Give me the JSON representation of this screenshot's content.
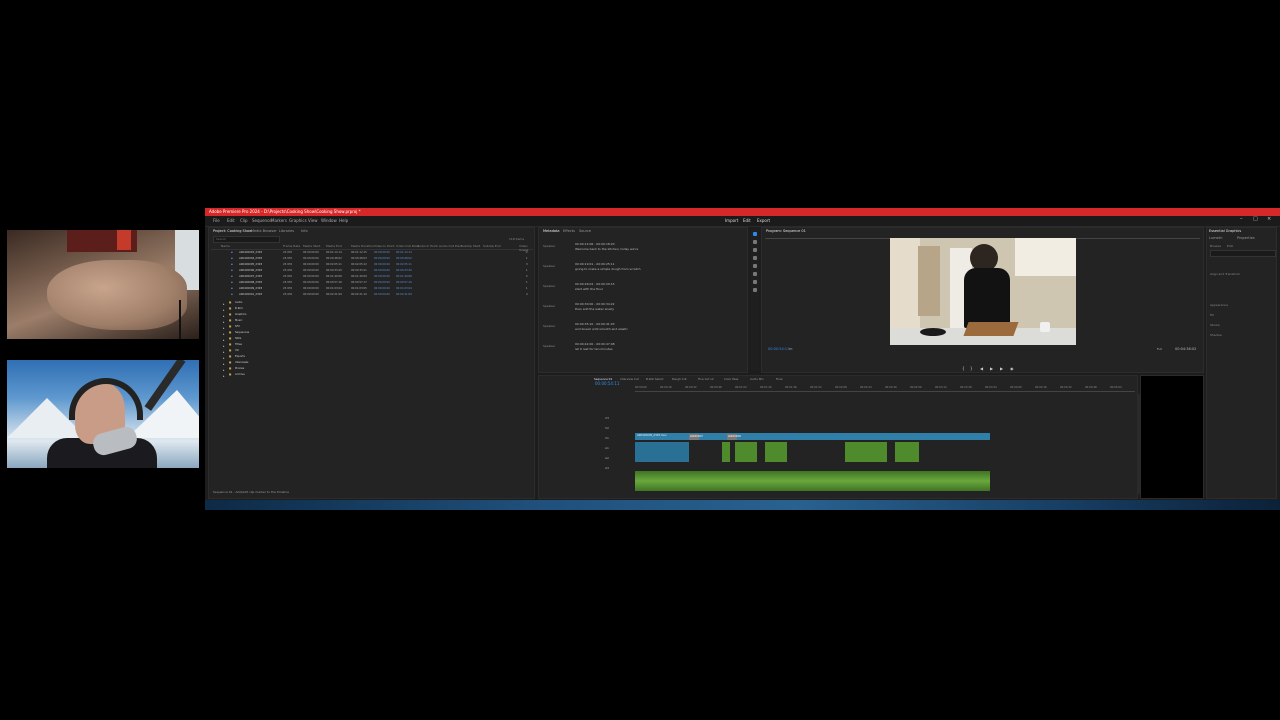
{
  "window": {
    "title": "Adobe Premiere Pro 2024 - D:\\Projects\\Cooking Show\\Cooking Show.prproj *",
    "menu": [
      "File",
      "Edit",
      "Clip",
      "Sequence",
      "Markers",
      "Graphics",
      "View",
      "Window",
      "Help"
    ],
    "controls": [
      "–",
      "□",
      "×"
    ]
  },
  "workspace_tabs": [
    "Import",
    "Edit",
    "Export"
  ],
  "project": {
    "tabs": [
      "Project: Cooking Show",
      "Media Browser",
      "Libraries",
      "Info"
    ],
    "search_placeholder": "Search",
    "item_count": "118 items",
    "columns": [
      "Name",
      "Frame Rate",
      "Media Start",
      "Media End",
      "Media Duration",
      "Video In Point",
      "Video Out Point",
      "Audio In Point",
      "Audio Out Point",
      "Subclip Start",
      "Subclip End",
      "Video Usage"
    ],
    "rows": [
      {
        "name": "A004C0003_2303",
        "fps": "23.976",
        "start": "00:00:00:00",
        "end": "00:01:12:14",
        "dur": "00:01:12:15",
        "vin": "00:00:00:00",
        "vout": "00:01:12:14",
        "use": "2"
      },
      {
        "name": "A004C0004_2303",
        "fps": "23.976",
        "start": "00:00:00:00",
        "end": "00:00:48:02",
        "dur": "00:00:48:03",
        "vin": "00:00:00:00",
        "vout": "00:00:48:02",
        "use": "1"
      },
      {
        "name": "A004C0005_2303",
        "fps": "23.976",
        "start": "00:00:00:00",
        "end": "00:02:05:11",
        "dur": "00:02:05:12",
        "vin": "00:00:00:00",
        "vout": "00:02:05:11",
        "use": "3"
      },
      {
        "name": "A004C0006_2303",
        "fps": "23.976",
        "start": "00:00:00:00",
        "end": "00:00:33:20",
        "dur": "00:00:33:21",
        "vin": "00:00:00:00",
        "vout": "00:00:33:20",
        "use": "1"
      },
      {
        "name": "A004C0007_2303",
        "fps": "23.976",
        "start": "00:00:00:00",
        "end": "00:01:40:08",
        "dur": "00:01:40:09",
        "vin": "00:00:00:00",
        "vout": "00:01:40:08",
        "use": "2"
      },
      {
        "name": "A004C0008_2303",
        "fps": "23.976",
        "start": "00:00:00:00",
        "end": "00:00:57:16",
        "dur": "00:00:57:17",
        "vin": "00:00:00:00",
        "vout": "00:00:57:16",
        "use": "1"
      },
      {
        "name": "A004C0009_2303",
        "fps": "23.976",
        "start": "00:00:00:00",
        "end": "00:01:03:04",
        "dur": "00:01:03:05",
        "vin": "00:00:00:00",
        "vout": "00:01:03:04",
        "use": "1"
      },
      {
        "name": "A004C0010_2303",
        "fps": "23.976",
        "start": "00:00:00:00",
        "end": "00:02:21:09",
        "dur": "00:02:21:10",
        "vin": "00:00:00:00",
        "vout": "00:02:21:09",
        "use": "4"
      }
    ],
    "bins": [
      "Audio",
      "B-Roll",
      "Graphics",
      "Music",
      "SFX",
      "Sequences",
      "Stills",
      "Titles",
      "VO",
      "Exports",
      "Interviews",
      "Proxies",
      "Archive"
    ],
    "footer": "Sequence 01 - Add/edit clip marker to the timeline"
  },
  "metadata": {
    "tabs": [
      "Metadata",
      "Effects",
      "Source"
    ],
    "entries": [
      {
        "label": "Speaker",
        "time": "00:00:12:06 - 00:00:18:20",
        "text": "Welcome back to the kitchen, today we're"
      },
      {
        "label": "Speaker",
        "time": "00:00:19:01 - 00:00:25:11",
        "text": "going to make a simple dough from scratch"
      },
      {
        "label": "Speaker",
        "time": "00:00:26:02 - 00:00:29:15",
        "text": "start with the flour"
      },
      {
        "label": "Speaker",
        "time": "00:00:30:00 - 00:00:34:22",
        "text": "then add the water slowly"
      },
      {
        "label": "Speaker",
        "time": "00:00:35:10 - 00:00:41:03",
        "text": "and knead until smooth and elastic"
      },
      {
        "label": "Speaker",
        "time": "00:00:42:00 - 00:00:47:08",
        "text": "let it rest for ten minutes"
      }
    ]
  },
  "program": {
    "tab": "Program: Sequence 01",
    "timecode_left": "00:00:54:11",
    "fit": "Fit",
    "quality": "Full",
    "timecode_right": "00:04:38:02"
  },
  "timeline": {
    "tabs": [
      "Sequence 01",
      "Interview Cut",
      "B-Roll Select",
      "Rough Cut",
      "Fine Cut v2",
      "Color Pass",
      "Audio Mix",
      "Final"
    ],
    "timecode": "00:00:54:11",
    "tracks": [
      "V3",
      "V2",
      "V1",
      "A1",
      "A2",
      "A3"
    ],
    "ruler": [
      "00:00:00",
      "00:00:16",
      "00:00:32",
      "00:00:48",
      "00:01:04",
      "00:01:20",
      "00:01:36",
      "00:01:52",
      "00:02:08",
      "00:02:24",
      "00:02:40",
      "00:02:56",
      "00:03:12",
      "00:03:28",
      "00:03:44",
      "00:04:00",
      "00:04:16",
      "00:04:32",
      "00:04:48",
      "00:05:04"
    ],
    "v1_clip": "A004C0005_2303.mov",
    "v2_clip1": "A004C0007",
    "v2_clip2": "A004C0009"
  },
  "essential": {
    "tabs": [
      "Essential Graphics",
      "Lumetri",
      "Properties"
    ],
    "labels": [
      "Browse",
      "Edit",
      "Align and Transform",
      "Appearance",
      "Fill",
      "Stroke",
      "Shadow"
    ]
  },
  "colors": {
    "title_bar": "#d62828",
    "clip_blue": "#2f7fa8",
    "clip_green": "#4f8a2c",
    "accent": "#2d8ceb"
  }
}
